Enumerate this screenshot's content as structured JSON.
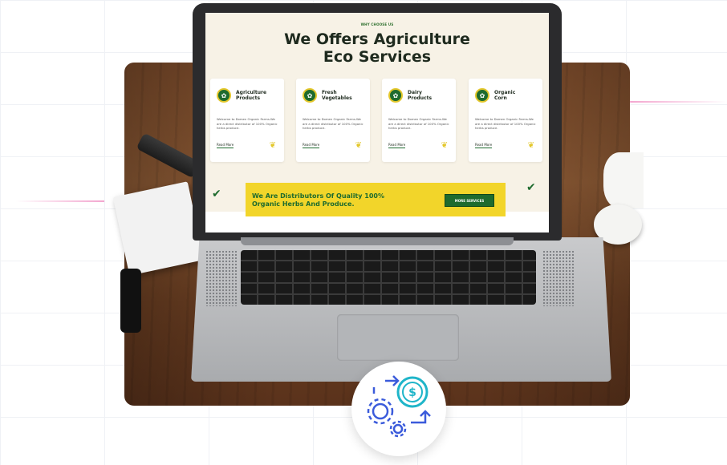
{
  "screen": {
    "eyebrow": "WHY CHOOSE US",
    "headline_line1": "We Offers Agriculture",
    "headline_line2": "Eco Services",
    "cards": [
      {
        "title_line1": "Agriculture",
        "title_line2": "Products",
        "desc": "Welcome to Domen Organic Farms.We are a direct distributor of 100% Organic herbs produce.",
        "link": "Read More",
        "icon": "apple-icon"
      },
      {
        "title_line1": "Fresh",
        "title_line2": "Vegetables",
        "desc": "Welcome to Domen Organic Farms.We are a direct distributor of 100% Organic herbs produce.",
        "link": "Read More",
        "icon": "carrot-icon"
      },
      {
        "title_line1": "Dairy",
        "title_line2": "Products",
        "desc": "Welcome to Domen Organic Farms.We are a direct distributor of 100% Organic herbs produce.",
        "link": "Read More",
        "icon": "milk-bottle-icon"
      },
      {
        "title_line1": "Organic",
        "title_line2": "Corn",
        "desc": "Welcome to Domen Organic Farms.We are a direct distributor of 100% Organic herbs produce.",
        "link": "Read More",
        "icon": "corn-icon"
      }
    ],
    "banner": {
      "text_line1": "We Are Distributors Of Quality 100%",
      "text_line2": "Organic Herbs And Produce.",
      "button": "MORE SERVICES"
    }
  },
  "badge": {
    "icon": "gear-dollar-icon"
  },
  "colors": {
    "brand_green": "#1e6b2e",
    "brand_yellow": "#f2d52a",
    "badge_blue": "#3b5bdb",
    "badge_teal": "#1fb5c9"
  }
}
